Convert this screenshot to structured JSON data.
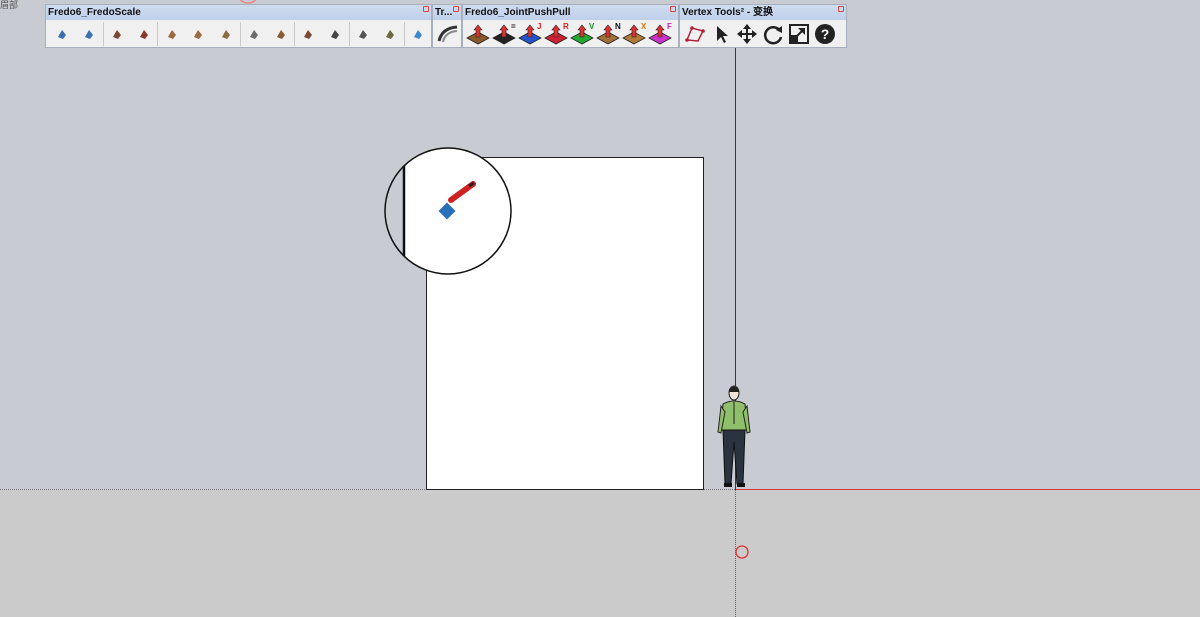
{
  "corner_label": "眉部",
  "toolbars": {
    "fredoscale": {
      "title": "Fredo6_FredoScale",
      "tools": [
        "scale-box-icon",
        "scale-box2-icon",
        "stretch-icon",
        "stretch2-icon",
        "twist-icon",
        "twist2-icon",
        "shear-icon",
        "plane-shear-icon",
        "radial-bend-icon",
        "taper-icon",
        "box-rotate-icon",
        "rotate-icon",
        "bend-icon",
        "untaper-icon"
      ]
    },
    "tr": {
      "title": "Tr..."
    },
    "jointpushpull": {
      "title": "Fredo6_JointPushPull",
      "tools": [
        {
          "icon": "joint-pushpull-icon",
          "letter": "",
          "color": "#8b5a2b",
          "letter_color": "#d22"
        },
        {
          "icon": "normal-pushpull-icon",
          "letter": "=",
          "color": "#222",
          "letter_color": "#111"
        },
        {
          "icon": "joint-pushpull-j-icon",
          "letter": "J",
          "color": "#2255cc",
          "letter_color": "#d22"
        },
        {
          "icon": "round-pushpull-icon",
          "letter": "R",
          "color": "#cc2233",
          "letter_color": "#d22"
        },
        {
          "icon": "vector-pushpull-icon",
          "letter": "V",
          "color": "#22aa33",
          "letter_color": "#1a8a2a"
        },
        {
          "icon": "normal-pushpull-n-icon",
          "letter": "N",
          "color": "#a0703a",
          "letter_color": "#111"
        },
        {
          "icon": "extrude-pushpull-icon",
          "letter": "X",
          "color": "#b07a3a",
          "letter_color": "#e07a00"
        },
        {
          "icon": "follow-pushpull-icon",
          "letter": "F",
          "color": "#cc33cc",
          "letter_color": "#cc22cc"
        }
      ]
    },
    "vertex": {
      "title": "Vertex Tools² - 变换",
      "tools": [
        "vertex-select-icon",
        "arrow-cursor-icon",
        "move-icon",
        "rotate-icon",
        "scale-icon",
        "help-icon"
      ]
    }
  },
  "colors": {
    "sky": "#c8ccd2",
    "ground": "#cbcbcb",
    "blue_axis": "#2a2ab0",
    "red_axis": "#d63a3a"
  }
}
